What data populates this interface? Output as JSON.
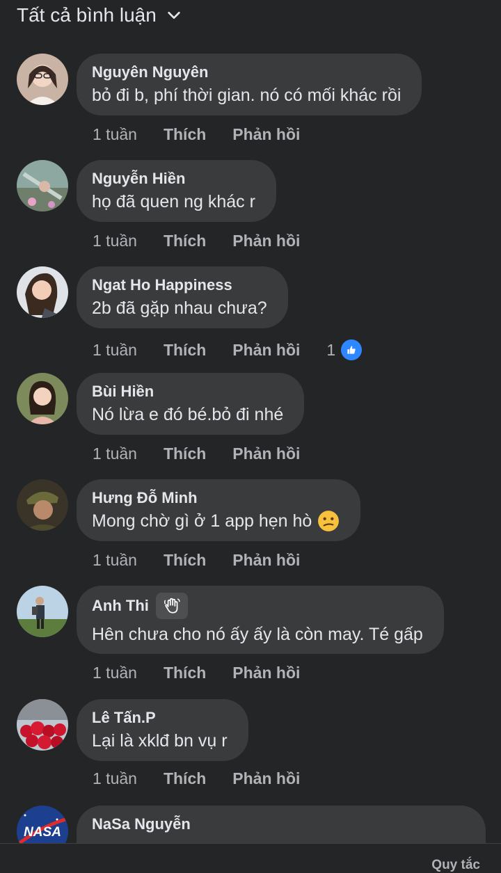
{
  "header": {
    "filter_label": "Tất cả bình luận"
  },
  "actions": {
    "like": "Thích",
    "reply": "Phản hồi"
  },
  "comments": [
    {
      "name": "Nguyên Nguyên",
      "text": "bỏ đi b, phí thời gian. nó có mối khác rồi",
      "time": "1 tuần"
    },
    {
      "name": "Nguyễn Hiền",
      "text": "họ đã quen ng khác r",
      "time": "1 tuần"
    },
    {
      "name": "Ngat Ho Happiness",
      "text": "2b đã gặp nhau chưa?",
      "time": "1 tuần",
      "reactions": "1"
    },
    {
      "name": "Bùi Hiền",
      "text": "Nó lừa e đó bé.bỏ đi nhé",
      "time": "1 tuần"
    },
    {
      "name": "Hưng Đỗ Minh",
      "text": "Mong chờ gì ở 1 app hẹn hò",
      "time": "1 tuần"
    },
    {
      "name": "Anh Thi",
      "text": "Hên chưa cho nó ấy ấy là còn may. Té gấp",
      "time": "1 tuần"
    },
    {
      "name": "Lê Tấn.P",
      "text": "Lại là xklđ bn vụ r",
      "time": "1 tuần"
    },
    {
      "name": "NaSa Nguyễn",
      "avatar_text": "NASA"
    }
  ],
  "footer": {
    "rules": "Quy tắc"
  },
  "colors": {
    "background": "#242526",
    "bubble": "#3a3b3c",
    "secondary_text": "#b0b3b8",
    "like_blue": "#2d88ff"
  }
}
